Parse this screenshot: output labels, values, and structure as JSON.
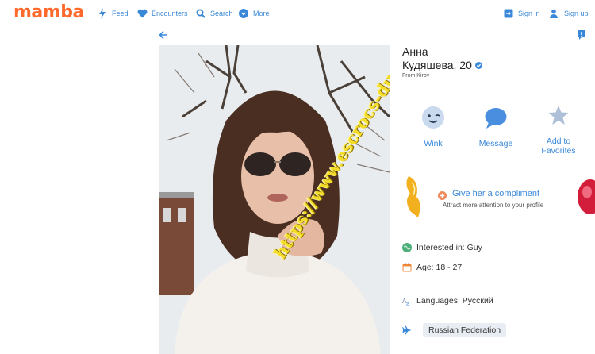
{
  "brand": {
    "logo": "mamba",
    "accent": "#ff6a2c",
    "link_color": "#3a88d8"
  },
  "nav": {
    "items": [
      {
        "label": "Feed",
        "icon": "lightning-icon"
      },
      {
        "label": "Encounters",
        "icon": "heart-icon"
      },
      {
        "label": "Search",
        "icon": "search-icon"
      },
      {
        "label": "More",
        "icon": "chevron-down-icon"
      }
    ],
    "sign_in": "Sign in",
    "sign_up": "Sign up"
  },
  "profile": {
    "first_name": "Анна",
    "last_name_age": "Кудяшева, 20",
    "from": "From Kirov",
    "watermark": "https://www.escrocs-du-web.fr"
  },
  "actions": {
    "wink": "Wink",
    "message": "Message",
    "favorites_line1": "Add to",
    "favorites_line2": "Favorites"
  },
  "compliment": {
    "title": "Give her a compliment",
    "subtitle": "Attract more attention to your profile"
  },
  "details": {
    "interested": "Interested in: Guy",
    "age": "Age: 18 - 27",
    "languages": "Languages: Русский",
    "country": "Russian Federation"
  }
}
